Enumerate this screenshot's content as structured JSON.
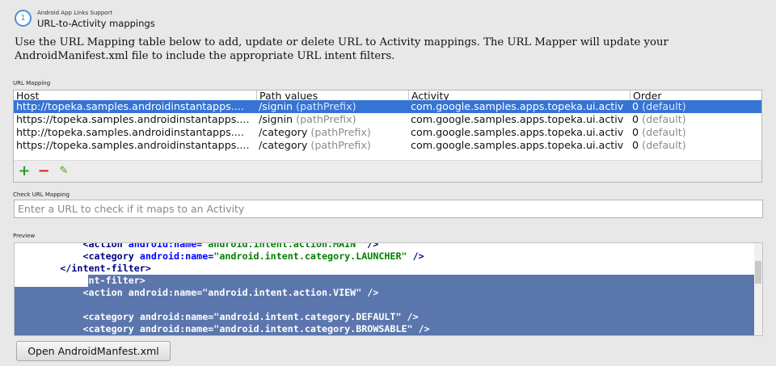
{
  "header": {
    "step_number": "1",
    "subtitle": "Android App Links Support",
    "title": "URL-to-Activity mappings"
  },
  "description": "Use the URL Mapping table below to add, update or delete URL to Activity mappings. The URL Mapper will update your AndroidManifest.xml file to include the appropriate URL intent filters.",
  "url_mapping": {
    "label": "URL Mapping",
    "columns": [
      "Host",
      "Path values",
      "Activity",
      "Order"
    ],
    "rows": [
      {
        "host": "http://topeka.samples.androidinstantapps....",
        "path": "/signin",
        "path_hint": "(pathPrefix)",
        "activity": "com.google.samples.apps.topeka.ui.activ",
        "order": "0",
        "order_hint": "(default)",
        "selected": true
      },
      {
        "host": "https://topeka.samples.androidinstantapps....",
        "path": "/signin",
        "path_hint": "(pathPrefix)",
        "activity": "com.google.samples.apps.topeka.ui.activ",
        "order": "0",
        "order_hint": "(default)",
        "selected": false
      },
      {
        "host": "http://topeka.samples.androidinstantapps....",
        "path": "/category",
        "path_hint": "(pathPrefix)",
        "activity": "com.google.samples.apps.topeka.ui.activ",
        "order": "0",
        "order_hint": "(default)",
        "selected": false
      },
      {
        "host": "https://topeka.samples.androidinstantapps....",
        "path": "/category",
        "path_hint": "(pathPrefix)",
        "activity": "com.google.samples.apps.topeka.ui.activ",
        "order": "0",
        "order_hint": "(default)",
        "selected": false
      }
    ],
    "toolbar": {
      "add_icon": "plus-icon",
      "remove_icon": "minus-icon",
      "edit_icon": "pencil-icon"
    }
  },
  "check_url": {
    "label": "Check URL Mapping",
    "placeholder": "Enter a URL to check if it maps to an Activity",
    "value": ""
  },
  "preview": {
    "label": "Preview",
    "lines": [
      {
        "indent": "            ",
        "tag_open": "<action",
        "attr": "android:name=",
        "value": "\"android.intent.action.MAIN\"",
        "tag_close": " />",
        "selected": false
      },
      {
        "indent": "            ",
        "tag_open": "<category",
        "attr": "android:name=",
        "value": "\"android.intent.category.LAUNCHER\"",
        "tag_close": " />",
        "selected": false
      },
      {
        "indent": "        ",
        "tag_open": "</intent-filter>",
        "attr": "",
        "value": "",
        "tag_close": "",
        "selected": false
      },
      {
        "indent": "        ",
        "tag_open": "<intent-filter>",
        "attr": "",
        "value": "",
        "tag_close": "",
        "selected": true
      },
      {
        "indent": "            ",
        "tag_open": "<action",
        "attr": "android:name=",
        "value": "\"android.intent.action.VIEW\"",
        "tag_close": " />",
        "selected": true
      },
      {
        "indent": "",
        "tag_open": "",
        "attr": "",
        "value": "",
        "tag_close": "",
        "selected": true
      },
      {
        "indent": "            ",
        "tag_open": "<category",
        "attr": "android:name=",
        "value": "\"android.intent.category.DEFAULT\"",
        "tag_close": " />",
        "selected": true
      },
      {
        "indent": "            ",
        "tag_open": "<category",
        "attr": "android:name=",
        "value": "\"android.intent.category.BROWSABLE\"",
        "tag_close": " />",
        "selected": true
      }
    ]
  },
  "open_manifest_button": "Open AndroidManfest.xml",
  "colors": {
    "selection": "#3574d4",
    "code_selection": "#5b76ad",
    "add_green": "#2e9a2e",
    "remove_red": "#dd2222",
    "step_blue": "#4a90d9"
  }
}
